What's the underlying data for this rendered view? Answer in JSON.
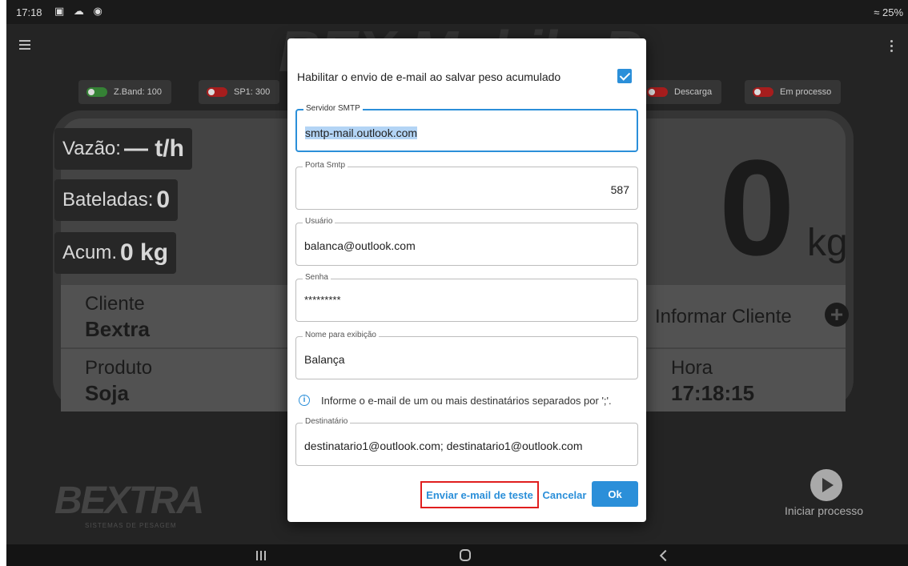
{
  "status_bar": {
    "time": "17:18",
    "notification_icons": "▣ ☁ ◉",
    "battery": "≈ 25%"
  },
  "app": {
    "title_fragment": "BEX Mobile P",
    "chips": [
      {
        "label": "Z.Band: 100",
        "state": "on"
      },
      {
        "label": "SP1: 300",
        "state": "off"
      },
      {
        "label": "Descarga",
        "state": "off"
      },
      {
        "label": "Em processo",
        "state": "off"
      }
    ],
    "stats": {
      "vazao_label": "Vazão:",
      "vazao_value": "— t/h",
      "bateladas_label": "Bateladas:",
      "bateladas_value": "0",
      "acum_label": "Acum.",
      "acum_value": "0 kg"
    },
    "weight": {
      "value": "0",
      "unit": "kg"
    },
    "cliente": {
      "label": "Cliente",
      "value": "Bextra",
      "action": "Informar Cliente"
    },
    "produto": {
      "label": "Produto",
      "value": "Soja"
    },
    "hora": {
      "label": "Hora",
      "value": "17:18:15"
    },
    "logo": {
      "text": "BEXTRA",
      "tagline": "SISTEMAS DE PESAGEM"
    },
    "start_process_label": "Iniciar processo"
  },
  "dialog": {
    "enable_label": "Habilitar o envio de e-mail ao salvar peso acumulado",
    "enable_checked": true,
    "fields": {
      "smtp_server": {
        "label": "Servidor SMTP",
        "value": "smtp-mail.outlook.com"
      },
      "smtp_port": {
        "label": "Porta Smtp",
        "value": "587"
      },
      "user": {
        "label": "Usuário",
        "value": "balanca@outlook.com"
      },
      "password": {
        "label": "Senha",
        "value": "*********"
      },
      "display_name": {
        "label": "Nome para exibição",
        "value": "Balança"
      },
      "recipient": {
        "label": "Destinatário",
        "value": "destinatario1@outlook.com; destinatario1@outlook.com"
      }
    },
    "info_text": "Informe o e-mail de um ou mais destinatários separados por ';'.",
    "buttons": {
      "test": "Enviar e-mail de teste",
      "cancel": "Cancelar",
      "ok": "Ok"
    }
  },
  "colors": {
    "accent": "#2b8fd9",
    "highlight_border": "#e01e1e",
    "background": "#282828"
  }
}
